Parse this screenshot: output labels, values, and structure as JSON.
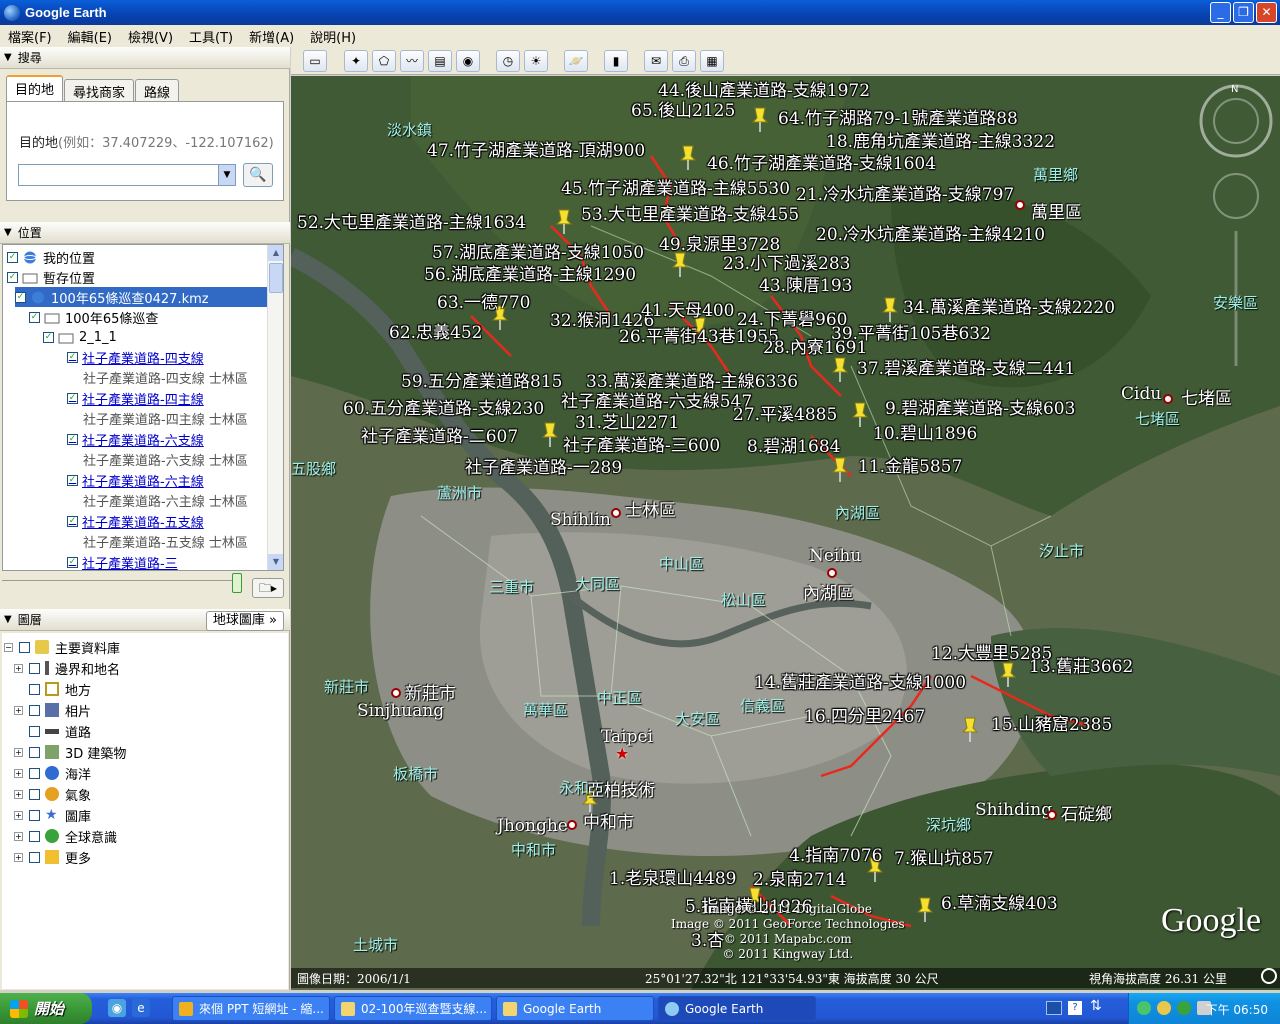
{
  "window": {
    "title": "Google Earth",
    "buttons": [
      "_",
      "❐",
      "✕"
    ]
  },
  "menu": [
    "檔案(F)",
    "編輯(E)",
    "檢視(V)",
    "工具(T)",
    "新增(A)",
    "說明(H)"
  ],
  "search": {
    "header": "搜尋",
    "tabs": [
      "目的地",
      "尋找商家",
      "路線"
    ],
    "hint_label": "目的地",
    "hint_example": "(例如：37.407229、-122.107162)",
    "input_value": ""
  },
  "places": {
    "header": "位置",
    "rows": [
      {
        "label": "我的位置"
      },
      {
        "label": "暫存位置"
      },
      {
        "label": "100年65條巡查0427.kmz"
      },
      {
        "label": "100年65條巡查"
      },
      {
        "label": "2_1_1"
      },
      {
        "label": "社子產業道路-四支線"
      },
      {
        "label": "社子產業道路-四支線 士林區"
      },
      {
        "label": "社子產業道路-四主線"
      },
      {
        "label": "社子產業道路-四主線 士林區"
      },
      {
        "label": "社子產業道路-六支線"
      },
      {
        "label": "社子產業道路-六支線 士林區"
      },
      {
        "label": "社子產業道路-六主線"
      },
      {
        "label": "社子產業道路-六主線 士林區"
      },
      {
        "label": "社子產業道路-五支線"
      },
      {
        "label": "社子產業道路-五支線 士林區"
      },
      {
        "label": "社子產業道路-三"
      }
    ]
  },
  "layers": {
    "header": "圖層",
    "gallery_button": "地球圖庫 »",
    "rows": [
      "主要資料庫",
      "邊界和地名",
      "地方",
      "相片",
      "道路",
      "3D 建築物",
      "海洋",
      "氣象",
      "圖庫",
      "全球意識",
      "更多"
    ]
  },
  "map": {
    "pin_labels": [
      "44.後山產業道路-支線1972",
      "65.後山2125",
      "64.竹子湖路79-1號產業道路88",
      "18.鹿角坑產業道路-主線3322",
      "47.竹子湖產業道路-頂湖900",
      "46.竹子湖產業道路-支線1604",
      "45.竹子湖產業道路-主線5530",
      "21.冷水坑產業道路-支線797",
      "52.大屯里產業道路-主線1634",
      "53.大屯里產業道路-支線455",
      "20.冷水坑產業道路-主線4210",
      "57.湖底產業道路-支線1050",
      "49.泉源里3728",
      "56.湖底產業道路-主線1290",
      "23.小下過溪283",
      "43.陳厝193",
      "63.一德770",
      "32.猴洞1426",
      "41.天母400",
      "24.下菁礐960",
      "34.萬溪產業道路-支線2220",
      "62.忠義452",
      "26.平菁街43巷1955",
      "39.平菁街105巷632",
      "28.內寮1691",
      "37.碧溪產業道路-支線二441",
      "59.五分產業道路815",
      "33.萬溪產業道路-主線6336",
      "社子產業道路-六支線547",
      "60.五分產業道路-支線230",
      "27.平溪4885",
      "9.碧湖產業道路-支線603",
      "31.芝山2271",
      "社子產業道路-二607",
      "10.碧山1896",
      "社子產業道路-三600",
      "8.碧湖1684",
      "11.金龍5857",
      "社子產業道路-一289",
      "12.大豐里5285",
      "13.舊莊3662",
      "14.舊莊產業道路-支線1000",
      "16.四分里2467",
      "15.山豬窟2385",
      "4.指南7076",
      "7.猴山坑857",
      "1.老泉環山4489",
      "2.泉南2714",
      "5.指南橫山1926",
      "6.草湳支線403",
      "3.杏"
    ],
    "districts": [
      "淡水鎮",
      "萬里鄉",
      "安樂區",
      "七堵區",
      "五股鄉",
      "蘆洲市",
      "內湖區",
      "汐止市",
      "三重市",
      "大同區",
      "中山區",
      "松山區",
      "新莊市",
      "萬華區",
      "中正區",
      "大安區",
      "信義區",
      "板橋市",
      "永和市",
      "中和市",
      "深坑鄉",
      "土城市"
    ],
    "cities": [
      "萬里區",
      "Cidu",
      "七堵區",
      "Shihlin",
      "士林區",
      "Neihu",
      "內湖區",
      "新莊市",
      "Sinjhuang",
      "Taipei",
      "亞柏技術",
      "Jhonghe",
      "中和市",
      "Shihding",
      "石碇鄉"
    ],
    "credits": [
      "Image © 2011 DigitalGlobe",
      "Image © 2011 GeoForce Technologies",
      "© 2011 Mapabc.com",
      "© 2011 Kingway Ltd."
    ],
    "google": "Google",
    "status_date": "圖像日期：2006/1/1",
    "status_coords": "25°01'27.32\"北 121°33'54.93\"東 海拔高度 30 公尺",
    "status_eye": "視角海拔高度 26.31 公里"
  },
  "taskbar": {
    "start": "開始",
    "tasks": [
      "來個 PPT 短網址 - 縮...",
      "02-100年巡查暨支線...",
      "Google Earth",
      "Google Earth"
    ],
    "clock": "下午 06:50"
  }
}
